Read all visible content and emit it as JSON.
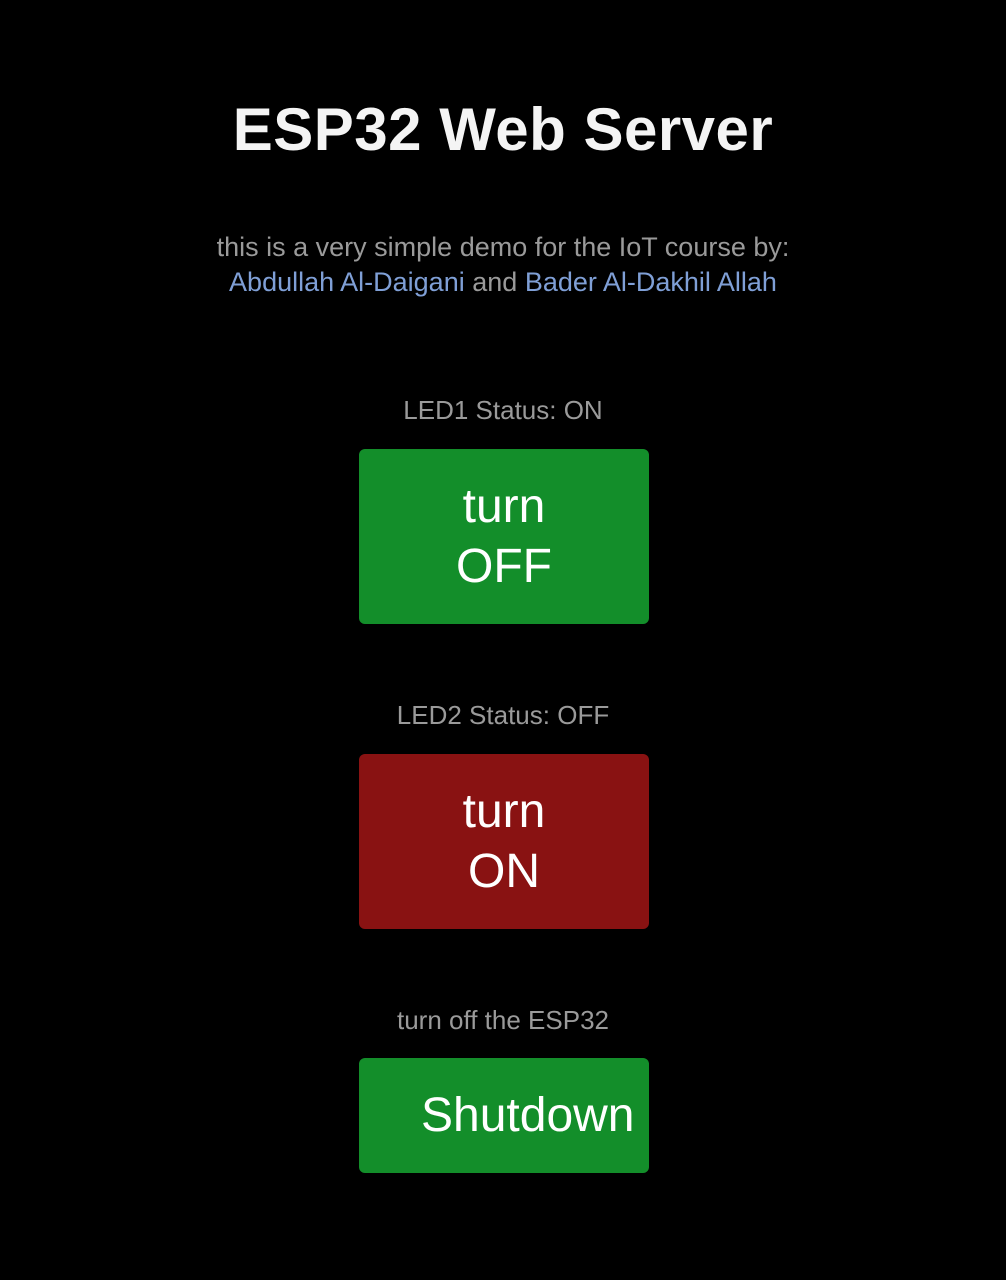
{
  "header": {
    "title": "ESP32 Web Server"
  },
  "intro": {
    "line1": "this is a very simple demo for the IoT course by:",
    "author1": "Abdullah Al-Daigani",
    "conjunction": "and",
    "author2": "Bader Al-Dakhil Allah"
  },
  "led1": {
    "status": "LED1 Status: ON",
    "button_line1": "turn",
    "button_line2": "OFF"
  },
  "led2": {
    "status": "LED2 Status: OFF",
    "button_line1": "turn",
    "button_line2": "ON"
  },
  "shutdown": {
    "label": "turn off the ESP32",
    "button": "Shutdown"
  },
  "colors": {
    "background": "#000000",
    "on_button": "#138e2a",
    "off_button": "#891212",
    "link": "#7f9fd6",
    "muted_text": "#9a9a9a"
  }
}
